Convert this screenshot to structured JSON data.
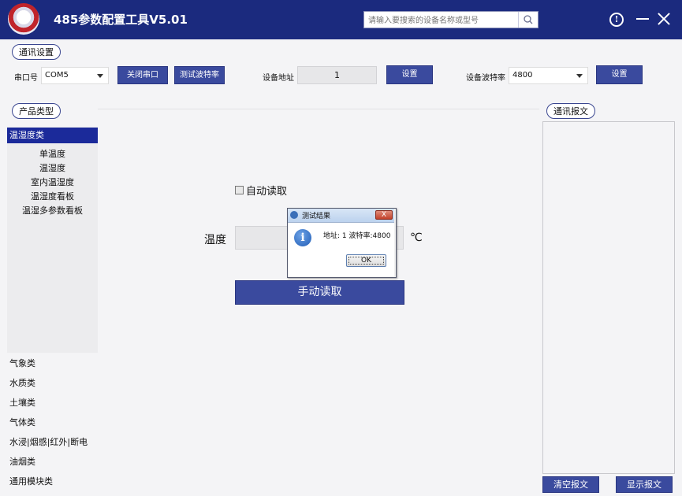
{
  "window": {
    "title": "485参数配置工具V5.01",
    "search_placeholder": "请输入要搜索的设备名称或型号",
    "icons": [
      "logo-icon",
      "search-icon",
      "info-icon",
      "minimize-icon",
      "close-icon"
    ]
  },
  "comm": {
    "section_label": "通讯设置",
    "port_label": "串口号",
    "port_value": "COM5",
    "close_port_label": "关闭串口",
    "test_baud_label": "测试波特率",
    "address_label": "设备地址",
    "address_value": "1",
    "address_set_label": "设置",
    "baud_label": "设备波特率",
    "baud_value": "4800",
    "baud_set_label": "设置"
  },
  "sidebar": {
    "section_label": "产品类型",
    "selected_category": "温湿度类",
    "sub_items": [
      "单温度",
      "温湿度",
      "室内温湿度",
      "温湿度看板",
      "温湿多参数看板"
    ],
    "categories": [
      "气象类",
      "水质类",
      "土壤类",
      "气体类",
      "水浸|烟感|红外|断电",
      "油烟类",
      "通用模块类"
    ]
  },
  "main": {
    "auto_read_label": "自动读取",
    "temp_label": "温度",
    "temp_value": "",
    "temp_unit": "℃",
    "manual_read_label": "手动读取"
  },
  "log": {
    "section_label": "通讯报文",
    "clear_label": "清空报文",
    "show_label": "显示报文"
  },
  "dialog": {
    "title": "测试结果",
    "message": "地址: 1  波特率:4800",
    "ok_label": "OK",
    "close_label": "X"
  },
  "colors": {
    "titlebar": "#1b2a7e",
    "button": "#3a4a9e",
    "selected": "#1b2a9a"
  }
}
